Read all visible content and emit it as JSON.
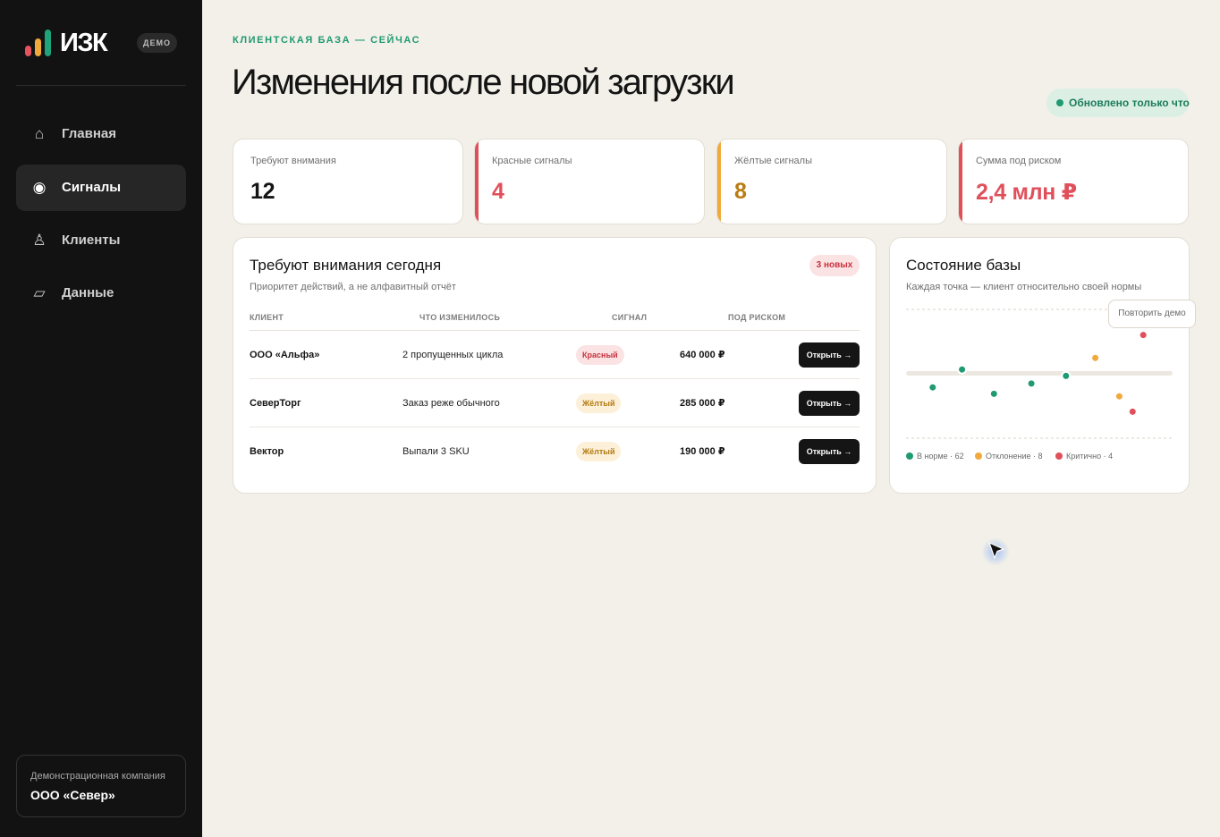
{
  "sidebar": {
    "logo_text": "ИЗК",
    "demo_badge": "ДЕМО",
    "items": [
      {
        "icon": "home-icon",
        "glyph": "⌂",
        "label": "Главная"
      },
      {
        "icon": "signal-icon",
        "glyph": "◉",
        "label": "Сигналы"
      },
      {
        "icon": "clients-icon",
        "glyph": "♙",
        "label": "Клиенты"
      },
      {
        "icon": "data-icon",
        "glyph": "▱",
        "label": "Данные"
      }
    ],
    "active_item": "Сигналы",
    "company": {
      "caption": "Демонстрационная компания",
      "name": "ООО «Север»"
    }
  },
  "header": {
    "eyebrow": "КЛИЕНТСКАЯ БАЗА — СЕЙЧАС",
    "title": "Изменения после новой загрузки",
    "status": "Обновлено только что"
  },
  "kpis": [
    {
      "label": "Требуют внимания",
      "value": "12",
      "color": "#141414",
      "accent": ""
    },
    {
      "label": "Красные сигналы",
      "value": "4",
      "color": "#e0505b",
      "accent": "#e0505b"
    },
    {
      "label": "Жёлтые сигналы",
      "value": "8",
      "color": "#b97c12",
      "accent": "#f0a93a"
    },
    {
      "label": "Сумма под риском",
      "value": "2,4 млн ₽",
      "color": "#e0505b",
      "accent": "#e0505b"
    }
  ],
  "attention": {
    "title": "Требуют внимания сегодня",
    "subtitle": "Приоритет действий, а не алфавитный отчёт",
    "new_badge": "3 новых",
    "columns": [
      "КЛИЕНТ",
      "ЧТО ИЗМЕНИЛОСЬ",
      "СИГНАЛ",
      "ПОД РИСКОМ"
    ],
    "rows": [
      {
        "client": "ООО «Альфа»",
        "change": "2 пропущенных цикла",
        "signal": "Красный",
        "level": "red",
        "amount": "640 000 ₽",
        "action": "Открыть →"
      },
      {
        "client": "СеверТорг",
        "change": "Заказ реже обычного",
        "signal": "Жёлтый",
        "level": "yellow",
        "amount": "285 000 ₽",
        "action": "Открыть →"
      },
      {
        "client": "Вектор",
        "change": "Выпали 3 SKU",
        "signal": "Жёлтый",
        "level": "yellow",
        "amount": "190 000 ₽",
        "action": "Открыть →"
      }
    ]
  },
  "base_state": {
    "title": "Состояние базы",
    "subtitle": "Каждая точка — клиент относительно своей нормы",
    "replay_button": "Повторить демо",
    "legend": [
      {
        "label": "В норме · 62",
        "color": "#1f9a72"
      },
      {
        "label": "Отклонение · 8",
        "color": "#f0a93a"
      },
      {
        "label": "Критично · 4",
        "color": "#e0505b"
      }
    ]
  },
  "colors": {
    "green": "#1f9a72",
    "yellow": "#f0a93a",
    "red": "#e0505b",
    "sidebar": "#121212",
    "background": "#f3f0e9"
  },
  "chart_data": {
    "type": "scatter",
    "title": "Состояние базы",
    "xlabel": "",
    "ylabel": "",
    "grid": false,
    "legend_position": "bottom",
    "baseline": 0,
    "ylim": [
      -1,
      1
    ],
    "xlim": [
      0,
      10
    ],
    "series": [
      {
        "name": "В норме · 62",
        "color": "#1f9a72",
        "points": [
          [
            1,
            -0.22
          ],
          [
            2.1,
            0.06
          ],
          [
            3.3,
            -0.32
          ],
          [
            4.7,
            -0.16
          ],
          [
            6,
            -0.04
          ]
        ]
      },
      {
        "name": "Отклонение · 8",
        "color": "#f0a93a",
        "points": [
          [
            7.1,
            0.24
          ],
          [
            8,
            -0.36
          ]
        ]
      },
      {
        "name": "Критично · 4",
        "color": "#e0505b",
        "points": [
          [
            8.9,
            0.6
          ],
          [
            8.5,
            -0.6
          ]
        ]
      }
    ]
  }
}
